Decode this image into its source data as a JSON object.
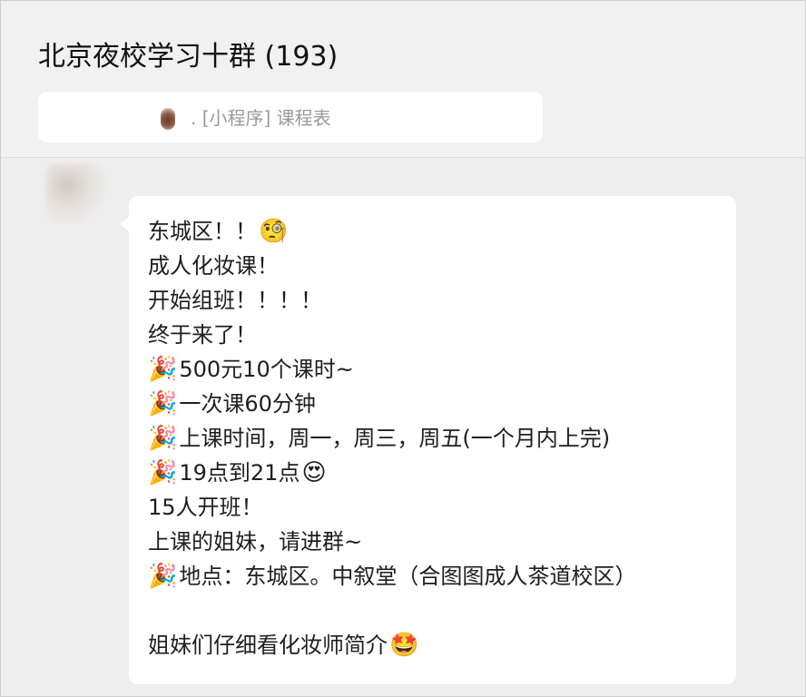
{
  "chat": {
    "title": "北京夜校学习十群 (193)",
    "pinned_text": ". [小程序] 课程表"
  },
  "message": {
    "lines": [
      {
        "prefix": "",
        "text": "东城区！！",
        "suffix": "🧐"
      },
      {
        "prefix": "",
        "text": "成人化妆课！",
        "suffix": ""
      },
      {
        "prefix": "",
        "text": "开始组班！！！！",
        "suffix": ""
      },
      {
        "prefix": "",
        "text": "终于来了！",
        "suffix": ""
      },
      {
        "prefix": "🎉",
        "text": "500元10个课时~",
        "suffix": ""
      },
      {
        "prefix": "🎉",
        "text": "一次课60分钟",
        "suffix": ""
      },
      {
        "prefix": "🎉",
        "text": "上课时间，周一，周三，周五(一个月内上完)",
        "suffix": ""
      },
      {
        "prefix": "🎉",
        "text": "19点到21点",
        "suffix": "😍"
      },
      {
        "prefix": "",
        "text": "15人开班！",
        "suffix": ""
      },
      {
        "prefix": "",
        "text": "上课的姐妹，请进群~",
        "suffix": ""
      },
      {
        "prefix": "🎉",
        "text": "地点：东城区。中叙堂（合图图成人茶道校区）",
        "suffix": ""
      },
      {
        "prefix": "",
        "text": "",
        "suffix": ""
      },
      {
        "prefix": "",
        "text": "姐妹们仔细看化妆师简介",
        "suffix": "🤩"
      }
    ]
  },
  "icons": {
    "party": "party-popper-icon",
    "thinking": "face-with-monocle-icon",
    "heart_eyes": "heart-eyes-icon",
    "star_struck": "star-struck-icon"
  }
}
